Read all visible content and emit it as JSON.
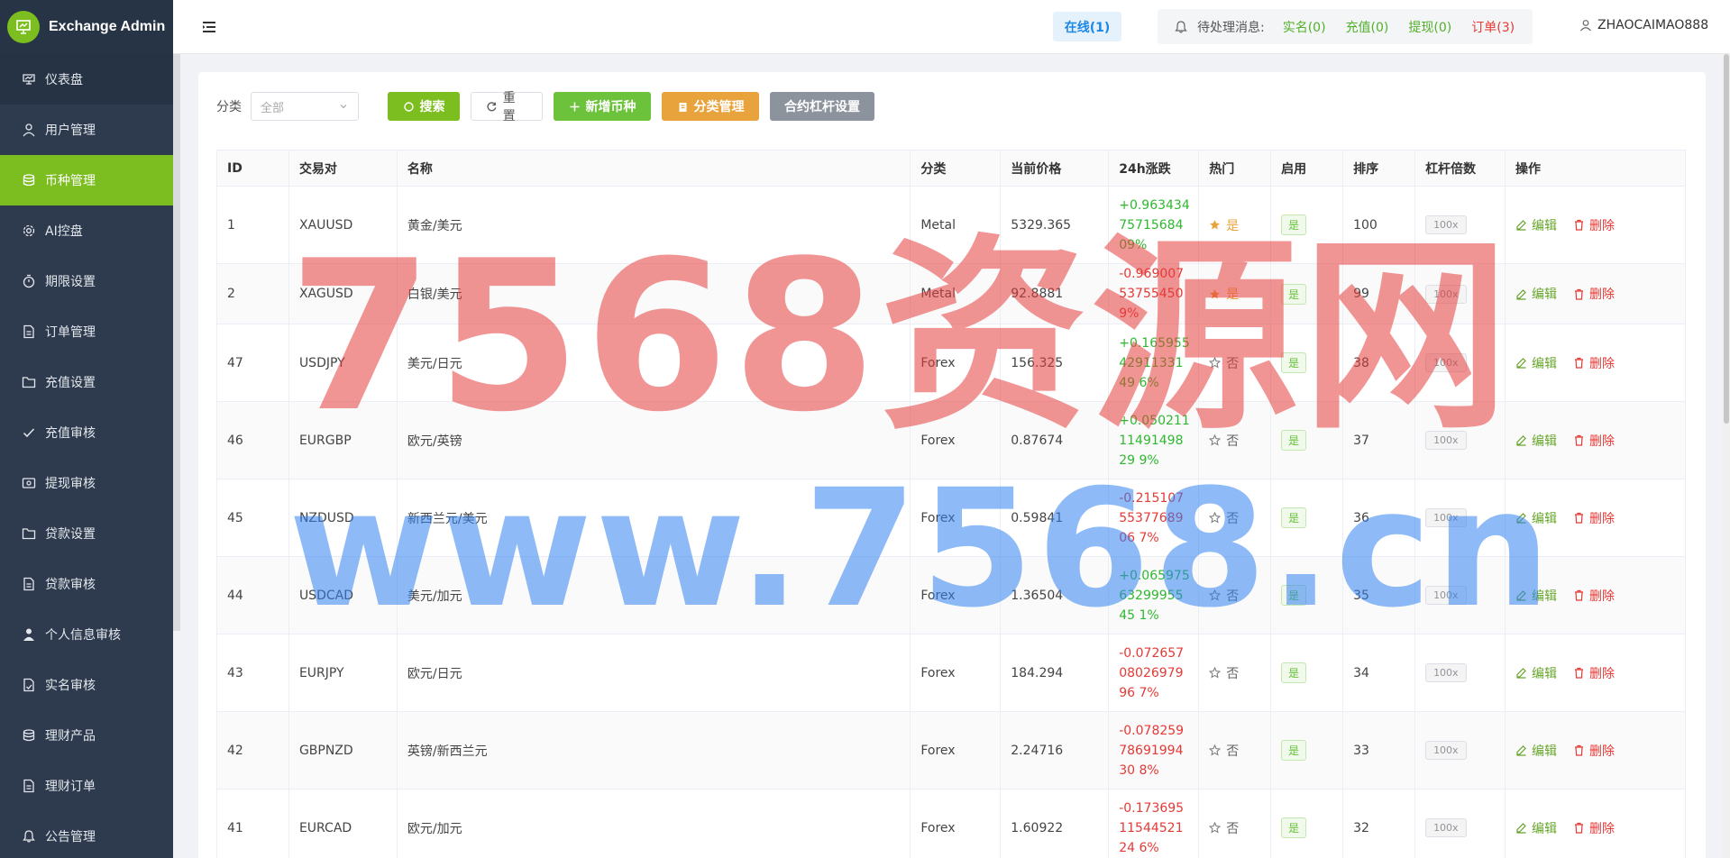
{
  "brand": {
    "title": "Exchange Admin"
  },
  "sidebar": {
    "items": [
      {
        "label": "仪表盘",
        "icon": "dashboard-icon"
      },
      {
        "label": "用户管理",
        "icon": "user-icon"
      },
      {
        "label": "币种管理",
        "icon": "database-icon",
        "active": true
      },
      {
        "label": "AI控盘",
        "icon": "gear-icon"
      },
      {
        "label": "期限设置",
        "icon": "timer-icon"
      },
      {
        "label": "订单管理",
        "icon": "document-icon"
      },
      {
        "label": "充值设置",
        "icon": "folder-icon"
      },
      {
        "label": "充值审核",
        "icon": "check-icon"
      },
      {
        "label": "提现审核",
        "icon": "wallet-icon"
      },
      {
        "label": "贷款设置",
        "icon": "folder-icon"
      },
      {
        "label": "贷款审核",
        "icon": "document-icon"
      },
      {
        "label": "个人信息审核",
        "icon": "person-icon"
      },
      {
        "label": "实名审核",
        "icon": "id-icon"
      },
      {
        "label": "理财产品",
        "icon": "database-icon"
      },
      {
        "label": "理财订单",
        "icon": "document-icon"
      },
      {
        "label": "公告管理",
        "icon": "bell-icon"
      }
    ]
  },
  "header": {
    "online": "在线(1)",
    "notify_label": "待处理消息:",
    "realname": "实名(0)",
    "recharge": "充值(0)",
    "withdraw": "提现(0)",
    "orders": "订单(3)",
    "username": "ZHAOCAIMAO888"
  },
  "toolbar": {
    "category_label": "分类",
    "category_value": "全部",
    "search": "搜索",
    "reset": "重置",
    "add": "新增币种",
    "category_manage": "分类管理",
    "leverage": "合约杠杆设置"
  },
  "table": {
    "headers": [
      "ID",
      "交易对",
      "名称",
      "分类",
      "当前价格",
      "24h涨跌",
      "热门",
      "启用",
      "排序",
      "杠杆倍数",
      "操作"
    ],
    "edit_label": "编辑",
    "delete_label": "删除",
    "rows": [
      {
        "id": "1",
        "pair": "XAUUSD",
        "name": "黄金/美元",
        "category": "Metal",
        "price": "5329.365",
        "change": "+0.9634347571568409%",
        "dir": "up",
        "hot": "是",
        "hot_on": true,
        "enabled": "是",
        "sort": "100",
        "leverage": "100x"
      },
      {
        "id": "2",
        "pair": "XAGUSD",
        "name": "白银/美元",
        "category": "Metal",
        "price": "92.8881",
        "change": "-0.969007537554509%",
        "dir": "down",
        "hot": "是",
        "hot_on": true,
        "enabled": "是",
        "sort": "99",
        "leverage": "100x"
      },
      {
        "id": "47",
        "pair": "USDJPY",
        "name": "美元/日元",
        "category": "Forex",
        "price": "156.325",
        "change": "+0.1659554291133149 6%",
        "dir": "up",
        "hot": "否",
        "hot_on": false,
        "enabled": "是",
        "sort": "38",
        "leverage": "100x"
      },
      {
        "id": "46",
        "pair": "EURGBP",
        "name": "欧元/英镑",
        "category": "Forex",
        "price": "0.87674",
        "change": "+0.0502111149149829 9%",
        "dir": "up",
        "hot": "否",
        "hot_on": false,
        "enabled": "是",
        "sort": "37",
        "leverage": "100x"
      },
      {
        "id": "45",
        "pair": "NZDUSD",
        "name": "新西兰元/美元",
        "category": "Forex",
        "price": "0.59841",
        "change": "-0.2151075537768906 7%",
        "dir": "down",
        "hot": "否",
        "hot_on": false,
        "enabled": "是",
        "sort": "36",
        "leverage": "100x"
      },
      {
        "id": "44",
        "pair": "USDCAD",
        "name": "美元/加元",
        "category": "Forex",
        "price": "1.36504",
        "change": "+0.0659756329995545 1%",
        "dir": "up",
        "hot": "否",
        "hot_on": false,
        "enabled": "是",
        "sort": "35",
        "leverage": "100x"
      },
      {
        "id": "43",
        "pair": "EURJPY",
        "name": "欧元/日元",
        "category": "Forex",
        "price": "184.294",
        "change": "-0.0726570802697996 7%",
        "dir": "down",
        "hot": "否",
        "hot_on": false,
        "enabled": "是",
        "sort": "34",
        "leverage": "100x"
      },
      {
        "id": "42",
        "pair": "GBPNZD",
        "name": "英镑/新西兰元",
        "category": "Forex",
        "price": "2.24716",
        "change": "-0.0782597869199430 8%",
        "dir": "down",
        "hot": "否",
        "hot_on": false,
        "enabled": "是",
        "sort": "33",
        "leverage": "100x"
      },
      {
        "id": "41",
        "pair": "EURCAD",
        "name": "欧元/加元",
        "category": "Forex",
        "price": "1.60922",
        "change": "-0.1736951154452124 6%",
        "dir": "down",
        "hot": "否",
        "hot_on": false,
        "enabled": "是",
        "sort": "32",
        "leverage": "100x"
      }
    ]
  },
  "watermark": {
    "line1": "7568资源网",
    "line2": "www.7568.cn"
  },
  "colors": {
    "accent": "#7cbd1f",
    "sidebar": "#2e3b4e",
    "up": "#2fb82f",
    "down": "#e53935",
    "hot": "#e8a33d"
  }
}
